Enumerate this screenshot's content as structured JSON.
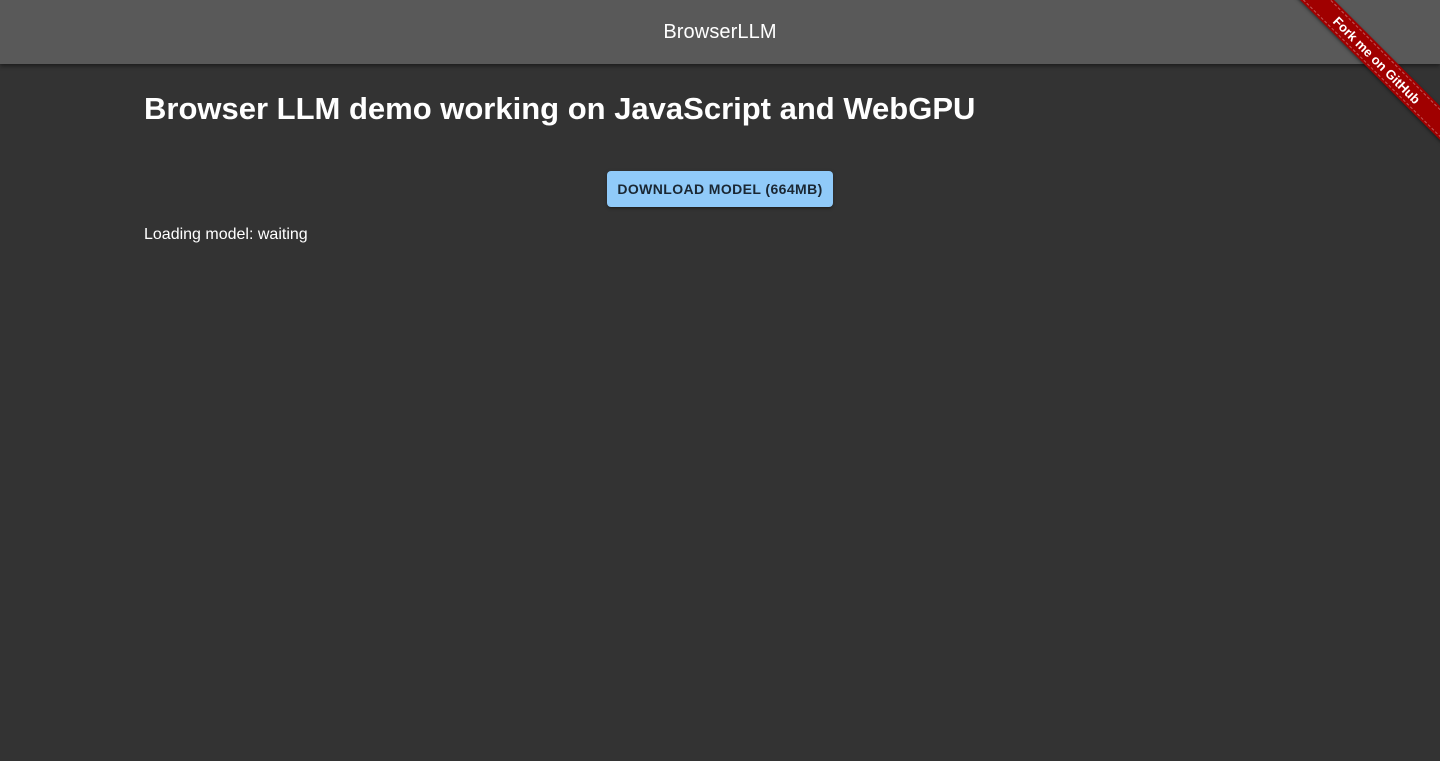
{
  "header": {
    "title": "BrowserLLM"
  },
  "main": {
    "heading": "Browser LLM demo working on JavaScript and WebGPU",
    "download_button_label": "DOWNLOAD MODEL (664MB)",
    "status_text": "Loading model: waiting"
  },
  "ribbon": {
    "label": "Fork me on GitHub"
  },
  "colors": {
    "background": "#333333",
    "app_bar": "#595959",
    "button": "#90caf9",
    "ribbon": "#a00000"
  }
}
